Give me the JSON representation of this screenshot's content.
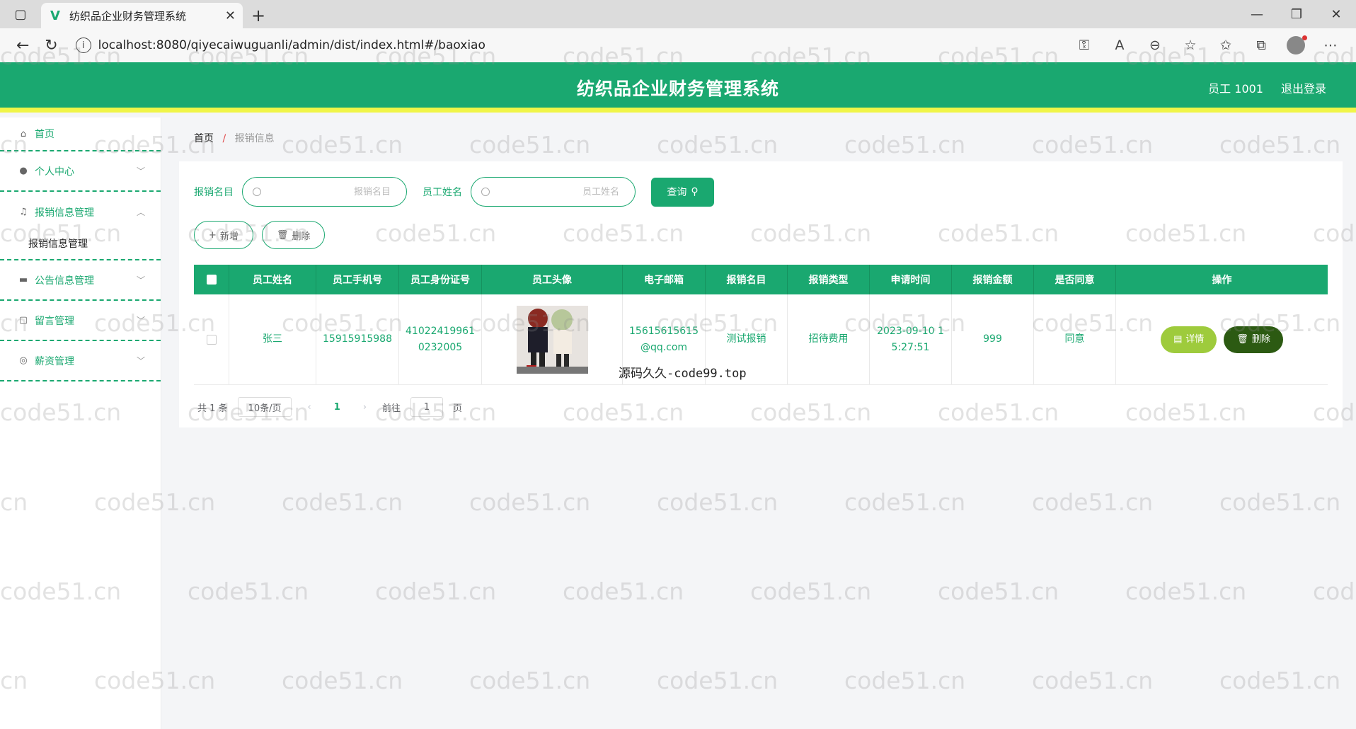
{
  "browser": {
    "tab_title": "纺织品企业财务管理系统",
    "url": "localhost:8080/qiyecaiwuguanli/admin/dist/index.html#/baoxiao"
  },
  "header": {
    "title": "纺织品企业财务管理系统",
    "user": "员工 1001",
    "logout": "退出登录"
  },
  "sidebar": {
    "items": [
      {
        "label": "首页",
        "icon": "home-icon"
      },
      {
        "label": "个人中心",
        "icon": "user-icon"
      },
      {
        "label": "报销信息管理",
        "icon": "bell-icon",
        "sub": "报销信息管理"
      },
      {
        "label": "公告信息管理",
        "icon": "monitor-icon"
      },
      {
        "label": "留言管理",
        "icon": "message-icon"
      },
      {
        "label": "薪资管理",
        "icon": "target-icon"
      }
    ]
  },
  "breadcrumb": {
    "home": "首页",
    "separator": "/",
    "current": "报销信息"
  },
  "search": {
    "item_label": "报销名目",
    "item_placeholder": "报销名目",
    "name_label": "员工姓名",
    "name_placeholder": "员工姓名",
    "query_label": "查询"
  },
  "actions": {
    "add_label": "新增",
    "delete_label": "删除"
  },
  "table": {
    "headers": [
      "员工姓名",
      "员工手机号",
      "员工身份证号",
      "员工头像",
      "电子邮箱",
      "报销名目",
      "报销类型",
      "申请时间",
      "报销金额",
      "是否同意",
      "操作"
    ],
    "rows": [
      {
        "name": "张三",
        "phone": "15915915988",
        "id_card": "410224199610232005",
        "email": "15615615615@qq.com",
        "item": "测试报销",
        "type": "招待费用",
        "time": "2023-09-10 15:27:51",
        "amount": "999",
        "agree": "同意",
        "detail_label": "详情",
        "delete_label": "删除"
      }
    ]
  },
  "pagination": {
    "total": "共 1 条",
    "page_size": "10条/页",
    "prev": "‹",
    "current": "1",
    "next": "›",
    "goto": "前往",
    "goto_value": "1",
    "page_suffix": "页"
  },
  "overlay_text": "源码久久-code99.top",
  "watermark": "code51.cn",
  "colors": {
    "primary": "#1aa870",
    "accent_bar": "#f0f548",
    "detail_btn": "#9ecb3c",
    "delete_btn": "#2c5a12"
  }
}
